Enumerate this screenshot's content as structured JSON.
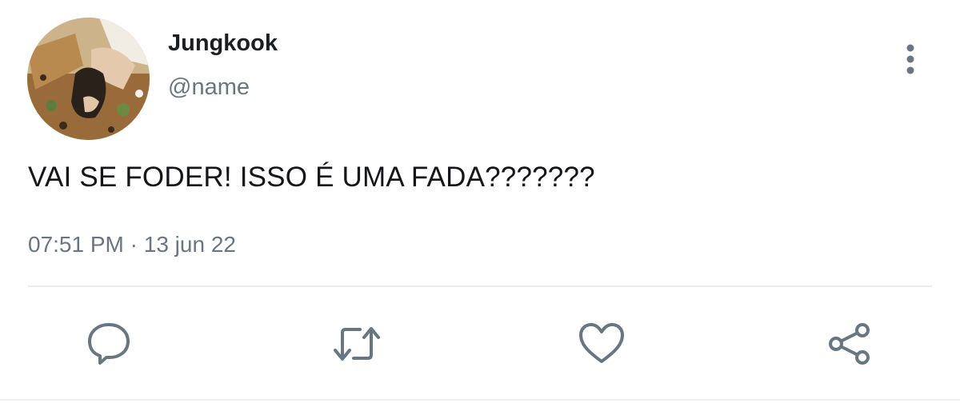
{
  "tweet": {
    "author": {
      "display_name": "Jungkook",
      "handle": "@name"
    },
    "text": "VAI SE FODER! ISSO É UMA FADA???????",
    "time": "07:51 PM",
    "separator": "·",
    "date": "13 jun 22"
  },
  "icons": {
    "more": "more-vertical-icon",
    "reply": "reply-icon",
    "retweet": "retweet-icon",
    "like": "heart-icon",
    "share": "share-icon"
  },
  "colors": {
    "icon": "#687684",
    "text": "#141619",
    "secondary_text": "#687684",
    "divider": "#e6ecf0"
  }
}
